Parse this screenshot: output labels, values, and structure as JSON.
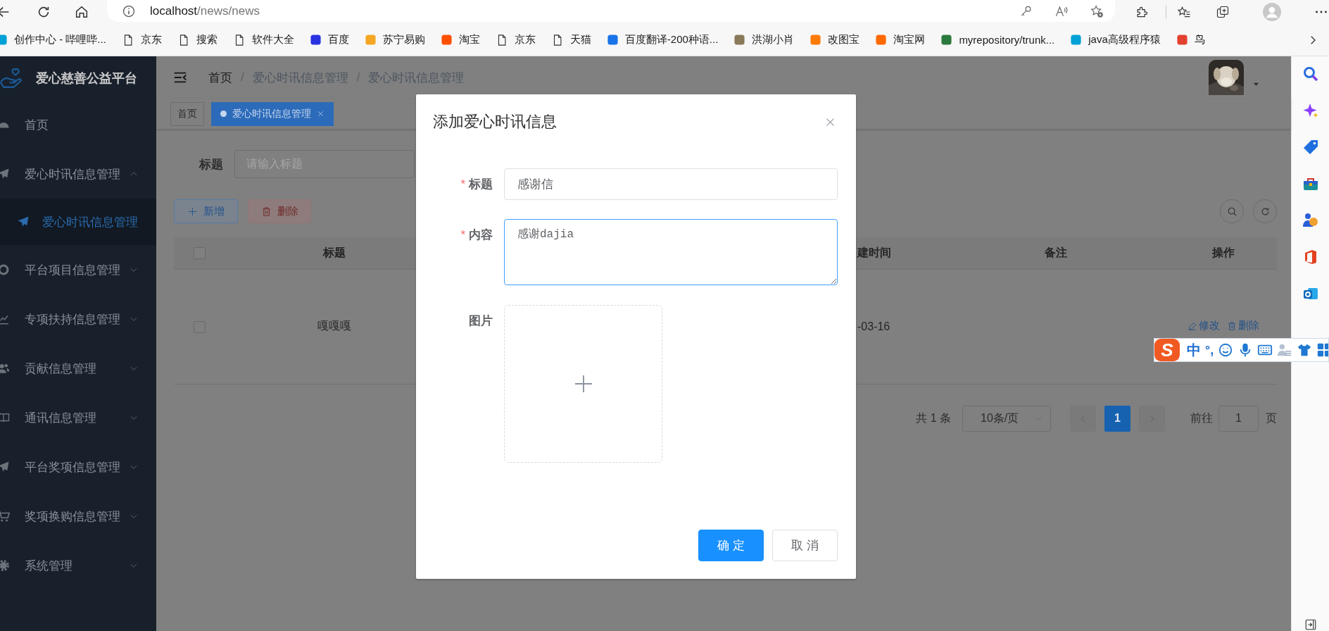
{
  "browser": {
    "address": {
      "host": "localhost",
      "path": "/news/news"
    },
    "bookmarks": [
      {
        "label": "创作中心 - 哔哩哔...",
        "kind": "site",
        "color": "#00a1d6"
      },
      {
        "label": "京东",
        "kind": "page"
      },
      {
        "label": "搜索",
        "kind": "page"
      },
      {
        "label": "软件大全",
        "kind": "page"
      },
      {
        "label": "百度",
        "kind": "site",
        "color": "#2932e1"
      },
      {
        "label": "苏宁易购",
        "kind": "site",
        "color": "#f5a623"
      },
      {
        "label": "淘宝",
        "kind": "site",
        "color": "#ff5000"
      },
      {
        "label": "京东",
        "kind": "page"
      },
      {
        "label": "天猫",
        "kind": "page"
      },
      {
        "label": "百度翻译-200种语...",
        "kind": "site",
        "color": "#1a73e8"
      },
      {
        "label": "洪湖小肖",
        "kind": "site",
        "color": "#8a7a5a"
      },
      {
        "label": "改图宝",
        "kind": "site",
        "color": "#ff7a00"
      },
      {
        "label": "淘宝网",
        "kind": "site",
        "color": "#ff6a00"
      },
      {
        "label": "myrepository/trunk...",
        "kind": "site",
        "color": "#2b7a3d"
      },
      {
        "label": "java高级程序猿",
        "kind": "site",
        "color": "#00a1d6"
      },
      {
        "label": "鸟",
        "kind": "site",
        "color": "#e2412f"
      }
    ]
  },
  "sidebar": {
    "title": "爱心慈善公益平台",
    "items": [
      {
        "label": "首页",
        "kind": "item",
        "selected": false
      },
      {
        "label": "爱心时讯信息管理",
        "kind": "submenu",
        "selected": false,
        "expanded": true,
        "children": [
          {
            "label": "爱心时讯信息管理",
            "selected": true
          }
        ]
      },
      {
        "label": "平台项目信息管理",
        "kind": "submenu",
        "selected": false,
        "expanded": false
      },
      {
        "label": "专项扶持信息管理",
        "kind": "submenu",
        "selected": false,
        "expanded": false
      },
      {
        "label": "贡献信息管理",
        "kind": "submenu",
        "selected": false,
        "expanded": false
      },
      {
        "label": "通讯信息管理",
        "kind": "submenu",
        "selected": false,
        "expanded": false
      },
      {
        "label": "平台奖项信息管理",
        "kind": "submenu",
        "selected": false,
        "expanded": false
      },
      {
        "label": "奖项换购信息管理",
        "kind": "submenu",
        "selected": false,
        "expanded": false
      },
      {
        "label": "系统管理",
        "kind": "submenu",
        "selected": false,
        "expanded": false
      }
    ]
  },
  "navbar": {
    "breadcrumb": [
      {
        "label": "首页",
        "separator": "/"
      },
      {
        "label": "爱心时讯信息管理",
        "separator": "/"
      },
      {
        "label": "爱心时讯信息管理"
      }
    ]
  },
  "tabs": [
    {
      "label": "首页",
      "selected": false
    },
    {
      "label": "爱心时讯信息管理",
      "selected": true
    }
  ],
  "search": {
    "label": "标题",
    "placeholder": "请输入标题"
  },
  "toolbar": {
    "buttons": [
      {
        "label": "新增",
        "kind": "add",
        "disabled": false
      },
      {
        "label": "删除",
        "kind": "delete",
        "disabled": true
      }
    ]
  },
  "table": {
    "all_selected": false,
    "columns": [
      {
        "label": "标题"
      },
      {
        "label": "建时间"
      },
      {
        "label": "备注"
      },
      {
        "label": "操作"
      }
    ],
    "rows": [
      {
        "selected": false,
        "title": "嘎嘎嘎",
        "column_3": "-03-16",
        "actions": [
          {
            "label": "修改",
            "kind": "edit"
          },
          {
            "label": "删除",
            "kind": "delete"
          }
        ]
      }
    ]
  },
  "pagination": {
    "total": "共 1 条",
    "page_size": "10条/页",
    "pages": [
      {
        "label": "1",
        "selected": true
      }
    ],
    "goto_label": "前往",
    "goto_value": "1",
    "goto_suffix": "页"
  },
  "dialog": {
    "title": "添加爱心时讯信息",
    "fields": [
      {
        "label": "标题",
        "mark": "*",
        "kind": "input",
        "value": "感谢信",
        "focused": false
      },
      {
        "label": "内容",
        "mark": "*",
        "kind": "textarea",
        "value": "感谢dajia",
        "focused": true
      },
      {
        "label": "图片",
        "kind": "upload"
      }
    ],
    "buttons": [
      {
        "label": "确定",
        "kind": "primary"
      },
      {
        "label": "取消",
        "kind": "default"
      }
    ]
  },
  "ime": {
    "logo": "S",
    "mode": "中",
    "punctuation": "°,"
  }
}
